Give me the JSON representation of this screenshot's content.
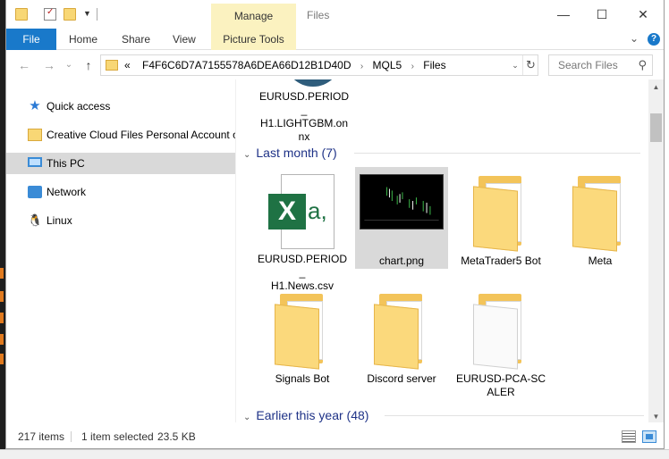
{
  "window": {
    "title": "Files",
    "context_tab": "Manage",
    "controls": {
      "minimize": "—",
      "maximize": "☐",
      "close": "✕"
    }
  },
  "ribbon": {
    "tabs": [
      "File",
      "Home",
      "Share",
      "View",
      "Picture Tools"
    ],
    "expand_chevron": "⌄",
    "help": "?"
  },
  "address_bar": {
    "overflow": "«",
    "breadcrumbs": [
      "F4F6C6D7A7155578A6DEA66D12B1D40D",
      "MQL5",
      "Files"
    ],
    "separator": "›",
    "dropdown": "⌄",
    "refresh": "↻"
  },
  "search": {
    "placeholder": "Search Files",
    "icon": "search-icon"
  },
  "nav_buttons": {
    "back": "←",
    "forward": "→",
    "recent": "⌄",
    "up": "↑"
  },
  "nav_pane": {
    "items": [
      {
        "label": "Quick access",
        "icon": "star-icon"
      },
      {
        "label": "Creative Cloud Files Personal Account o",
        "icon": "folder-icon"
      },
      {
        "label": "This PC",
        "icon": "computer-icon",
        "selected": true
      },
      {
        "label": "Network",
        "icon": "network-icon"
      },
      {
        "label": "Linux",
        "icon": "linux-icon"
      }
    ]
  },
  "content": {
    "top_item": {
      "name": "EURUSD.PERIOD_H1.LIGHTGBM.onnx",
      "lines": [
        "EURUSD.PERIOD_",
        "H1.LIGHTGBM.on",
        "nx"
      ]
    },
    "groups": [
      {
        "title": "Last month (7)",
        "chevron": "⌄"
      },
      {
        "title": "Earlier this year (48)",
        "chevron": "⌄"
      }
    ],
    "items": [
      {
        "name_lines": [
          "EURUSD.PERIOD_",
          "H1.News.csv"
        ],
        "type": "csv"
      },
      {
        "name_lines": [
          "chart.png"
        ],
        "type": "image",
        "selected": true
      },
      {
        "name_lines": [
          "MetaTrader5 Bot"
        ],
        "type": "folder"
      },
      {
        "name_lines": [
          "Meta"
        ],
        "type": "folder"
      },
      {
        "name_lines": [
          "Signals Bot"
        ],
        "type": "folder"
      },
      {
        "name_lines": [
          "Discord server"
        ],
        "type": "folder"
      },
      {
        "name_lines": [
          "EURUSD-PCA-SC",
          "ALER"
        ],
        "type": "folder"
      }
    ]
  },
  "scrollbar": {
    "up": "▲",
    "down": "▼"
  },
  "status_bar": {
    "item_count": "217 items",
    "selection": "1 item selected",
    "size": "23.5 KB"
  },
  "colors": {
    "accent": "#1979ca",
    "context_tab": "#fbf2c0",
    "group_header": "#1e3287",
    "selected": "#d9d9d9",
    "excel_green": "#1f7244",
    "folder": "#fbd97c"
  }
}
